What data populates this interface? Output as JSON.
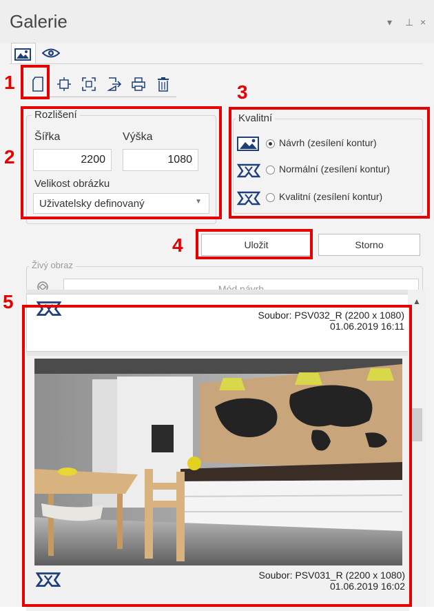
{
  "panel": {
    "title": "Galerie",
    "controls": {
      "dropdown": "▾",
      "pin": "⊥",
      "close": "×"
    }
  },
  "tabs": [
    {
      "name": "gallery-tab",
      "icon": "image-icon"
    },
    {
      "name": "preview-tab",
      "icon": "eye-icon"
    }
  ],
  "toolbar": {
    "icons": [
      "new-page-icon",
      "center-view-icon",
      "fit-frame-icon",
      "export-icon",
      "print-icon",
      "delete-icon"
    ]
  },
  "resolution": {
    "legend": "Rozlišení",
    "width_label": "Šířka",
    "height_label": "Výška",
    "width_value": "2200",
    "height_value": "1080",
    "size_label": "Velikost obrázku",
    "size_value": "Uživatelsky definovaný"
  },
  "quality": {
    "legend": "Kvalitní",
    "options": [
      {
        "label": "Návrh (zesílení kontur)",
        "selected": true,
        "icon": "image-icon"
      },
      {
        "label": "Normální (zesílení kontur)",
        "selected": false,
        "icon": "render-icon"
      },
      {
        "label": "Kvalitní (zesílení kontur)",
        "selected": false,
        "icon": "render-icon"
      }
    ]
  },
  "buttons": {
    "save": "Uložit",
    "cancel": "Storno"
  },
  "live": {
    "legend": "Živý obraz",
    "mode": "Mód návrh"
  },
  "gallery": {
    "items": [
      {
        "file": "Soubor: PSV032_R (2200 x 1080)",
        "date": "01.06.2019 16:11"
      },
      {
        "file": "Soubor: PSV031_R (2200 x 1080)",
        "date": "01.06.2019 16:02"
      }
    ]
  },
  "markers": [
    "1",
    "2",
    "3",
    "4",
    "5"
  ],
  "colors": {
    "highlight": "#e60000",
    "icon_blue": "#1f3f7a"
  }
}
